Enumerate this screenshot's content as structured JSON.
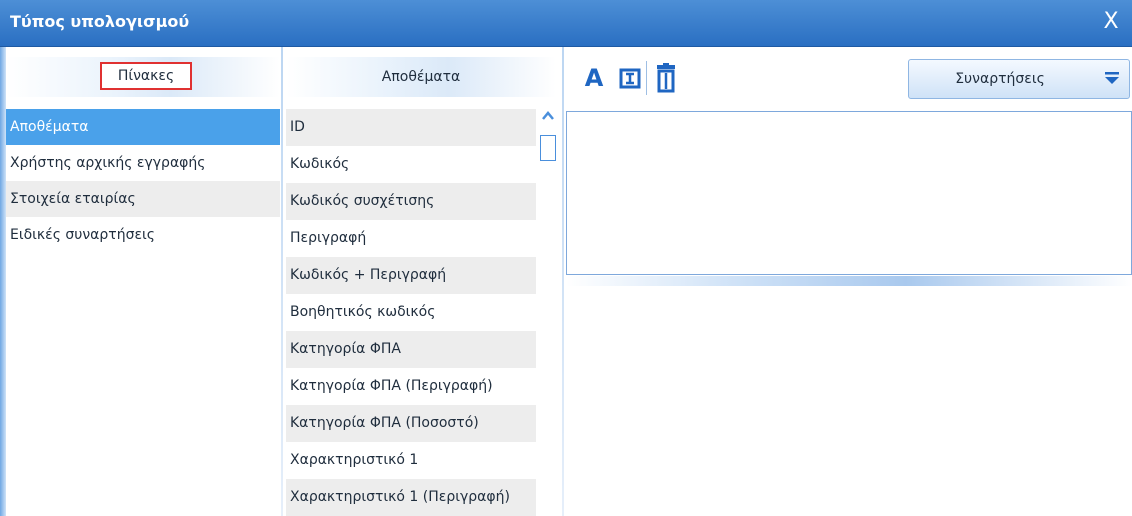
{
  "window": {
    "title": "Τύπος υπολογισμού",
    "close_label": "X"
  },
  "tables": {
    "header": "Πίνακες",
    "items": [
      "Αποθέματα",
      "Χρήστης αρχικής εγγραφής",
      "Στοιχεία εταιρίας",
      "Ειδικές συναρτήσεις"
    ],
    "selected": "Αποθέματα"
  },
  "fields": {
    "header": "Αποθέματα",
    "items": [
      "ID",
      "Κωδικός",
      "Κωδικός συσχέτισης",
      "Περιγραφή",
      "Κωδικός + Περιγραφή",
      "Βοηθητικός κωδικός",
      "Κατηγορία ΦΠΑ",
      "Κατηγορία ΦΠΑ (Περιγραφή)",
      "Κατηγορία ΦΠΑ (Ποσοστό)",
      "Χαρακτηριστικό 1",
      "Χαρακτηριστικό 1 (Περιγραφή)"
    ]
  },
  "toolbar": {
    "font_glyph": "A",
    "icons": [
      "font-icon",
      "text-box-icon",
      "trash-icon"
    ],
    "functions_label": "Συναρτήσεις"
  },
  "editor": {
    "value": ""
  },
  "colors": {
    "title_bar": "#2a6fc2",
    "selected_row": "#4aa1ea",
    "accent_icon": "#1f66c2",
    "highlight_border": "#e03131"
  }
}
